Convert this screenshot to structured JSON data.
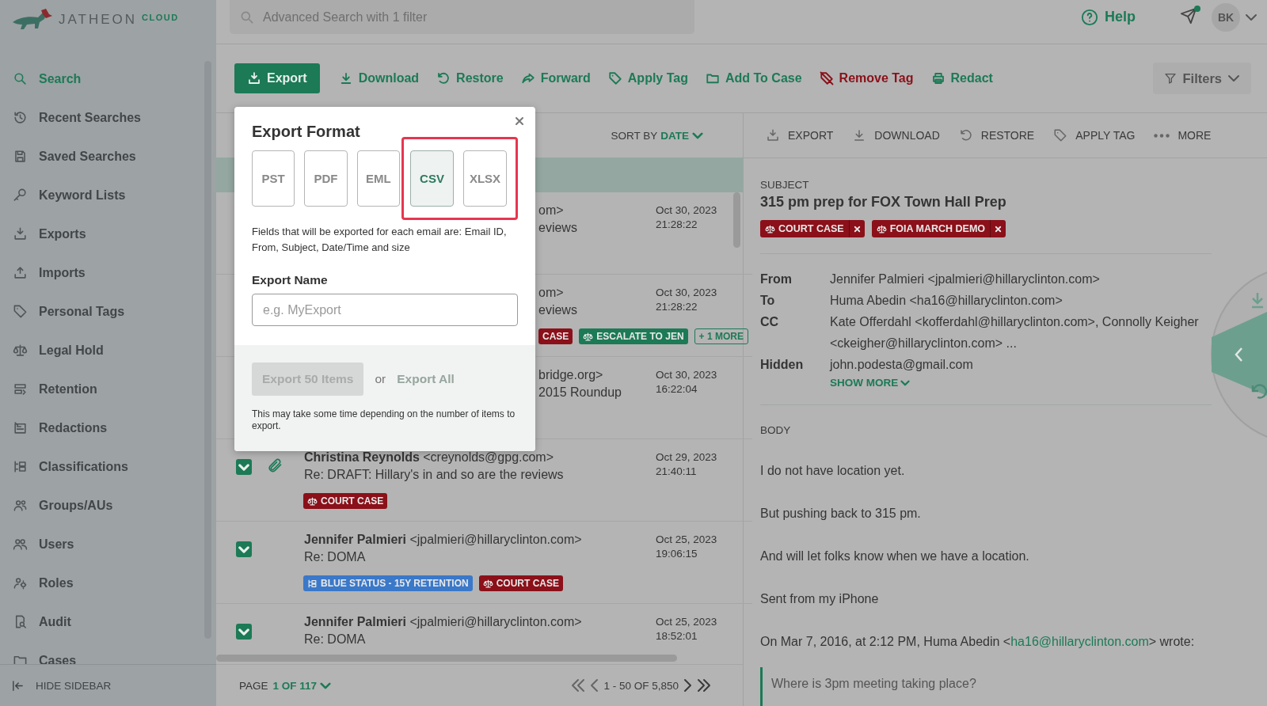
{
  "logo": {
    "name": "JATHEON",
    "suffix": "CLOUD"
  },
  "sidebar": {
    "items": [
      {
        "label": "Search",
        "selected": true
      },
      {
        "label": "Recent Searches",
        "selected": false
      },
      {
        "label": "Saved Searches",
        "selected": false
      },
      {
        "label": "Keyword Lists",
        "selected": false
      },
      {
        "label": "Exports",
        "selected": false
      },
      {
        "label": "Imports",
        "selected": false
      },
      {
        "label": "Personal Tags",
        "selected": false
      },
      {
        "label": "Legal Hold",
        "selected": false
      },
      {
        "label": "Retention",
        "selected": false
      },
      {
        "label": "Redactions",
        "selected": false
      },
      {
        "label": "Classifications",
        "selected": false
      },
      {
        "label": "Groups/AUs",
        "selected": false
      },
      {
        "label": "Users",
        "selected": false
      },
      {
        "label": "Roles",
        "selected": false
      },
      {
        "label": "Audit",
        "selected": false
      },
      {
        "label": "Cases",
        "selected": false
      }
    ],
    "hide_label": "HIDE SIDEBAR"
  },
  "search": {
    "placeholder": "Advanced Search with 1 filter"
  },
  "header": {
    "help": "Help",
    "notification": true,
    "avatar": "BK"
  },
  "toolbar": [
    {
      "label": "Export",
      "kind": "primary"
    },
    {
      "label": "Download",
      "kind": "plain"
    },
    {
      "label": "Restore",
      "kind": "plain"
    },
    {
      "label": "Forward",
      "kind": "plain"
    },
    {
      "label": "Apply Tag",
      "kind": "plain"
    },
    {
      "label": "Add To Case",
      "kind": "plain"
    },
    {
      "label": "Remove Tag",
      "kind": "danger"
    },
    {
      "label": "Redact",
      "kind": "plain"
    }
  ],
  "filters": "Filters",
  "list": {
    "sort_label": "SORT BY",
    "sort_value": "DATE",
    "rows": [
      {
        "kind": "partial",
        "from": "om>",
        "subject": "eviews",
        "date": "Oct 30, 2023",
        "time": "21:28:22",
        "tags": []
      },
      {
        "kind": "partial",
        "from": "om>",
        "subject": "eviews",
        "date": "Oct 30, 2023",
        "time": "21:28:22",
        "tags": [
          {
            "label": "CASE",
            "kind": "plain",
            "color": "#8b1019"
          },
          {
            "label": "ESCALATE TO JEN",
            "kind": "hold",
            "color": "#1c7a56"
          },
          {
            "label": "+ 1 MORE",
            "kind": "more"
          }
        ]
      },
      {
        "kind": "partial",
        "from": "bridge.org>",
        "subject": "2015 Roundup",
        "date": "Oct 30, 2023",
        "time": "16:22:04",
        "tags": []
      },
      {
        "kind": "full",
        "checked": true,
        "attachment": true,
        "name": "Christina Reynolds",
        "email": "<creynolds@gpg.com>",
        "subject": "Re: DRAFT: Hillary's in and so are the reviews",
        "date": "Oct 29, 2023",
        "time": "21:40:11",
        "tags": [
          {
            "label": "COURT CASE",
            "kind": "hold",
            "color": "#8b1019"
          }
        ]
      },
      {
        "kind": "full",
        "checked": true,
        "attachment": false,
        "name": "Jennifer Palmieri",
        "email": "<jpalmieri@hillaryclinton.com>",
        "subject": "Re: DOMA",
        "date": "Oct 25, 2023",
        "time": "19:06:15",
        "tags": [
          {
            "label": "BLUE STATUS - 15Y RETENTION",
            "kind": "classification",
            "color": "#3a78c9"
          },
          {
            "label": "COURT CASE",
            "kind": "hold",
            "color": "#8b1019"
          }
        ]
      },
      {
        "kind": "full",
        "checked": true,
        "attachment": false,
        "name": "Jennifer Palmieri",
        "email": "<jpalmieri@hillaryclinton.com>",
        "subject": "Re: DOMA",
        "date": "Oct 25, 2023",
        "time": "18:52:01",
        "tags": []
      }
    ],
    "page_label": "PAGE",
    "page_value": "1 OF 117",
    "range": "1 - 50 OF 5,850"
  },
  "preview": {
    "actions": [
      "EXPORT",
      "DOWNLOAD",
      "RESTORE",
      "APPLY TAG",
      "MORE"
    ],
    "subject_label": "SUBJECT",
    "subject": "315 pm prep for FOX Town Hall Prep",
    "tags": [
      {
        "label": "COURT CASE",
        "color": "#8b1019"
      },
      {
        "label": "FOIA MARCH DEMO",
        "color": "#8b1019"
      }
    ],
    "fields": [
      {
        "label": "From",
        "value": "Jennifer Palmieri <jpalmieri@hillaryclinton.com>"
      },
      {
        "label": "To",
        "value": "Huma Abedin <ha16@hillaryclinton.com>"
      },
      {
        "label": "CC",
        "value": "Kate Offerdahl <kofferdahl@hillaryclinton.com>, Connolly Keigher <ckeigher@hillaryclinton.com> ..."
      },
      {
        "label": "Hidden",
        "value": "john.podesta@gmail.com"
      }
    ],
    "show_more": "SHOW MORE",
    "body_label": "BODY",
    "paragraphs": [
      "I do not have location yet.",
      "But pushing back to 315 pm.",
      "And will let folks know when we have a location.",
      "Sent from my iPhone"
    ],
    "reply_line": {
      "before": "On Mar 7, 2016, at 2:12 PM, Huma Abedin <",
      "link": "ha16@hillaryclinton.com",
      "after": "> wrote:"
    },
    "quote": "Where is 3pm meeting taking place?"
  },
  "modal": {
    "title": "Export Format",
    "formats": [
      {
        "label": "PST",
        "selected": false,
        "highlighted": false
      },
      {
        "label": "PDF",
        "selected": false,
        "highlighted": false
      },
      {
        "label": "EML",
        "selected": false,
        "highlighted": false
      },
      {
        "label": "CSV",
        "selected": true,
        "highlighted": true
      },
      {
        "label": "XLSX",
        "selected": false,
        "highlighted": true
      }
    ],
    "description": "Fields that will be exported for each email are: Email ID, From, Subject, Date/Time and size",
    "name_label": "Export Name",
    "name_placeholder": "e.g. MyExport",
    "export_button": {
      "label": "Export 50 Items",
      "disabled": true
    },
    "or": "or",
    "export_all": {
      "label": "Export All",
      "disabled": true
    },
    "note": "This may take some time depending on the number of items to export."
  }
}
